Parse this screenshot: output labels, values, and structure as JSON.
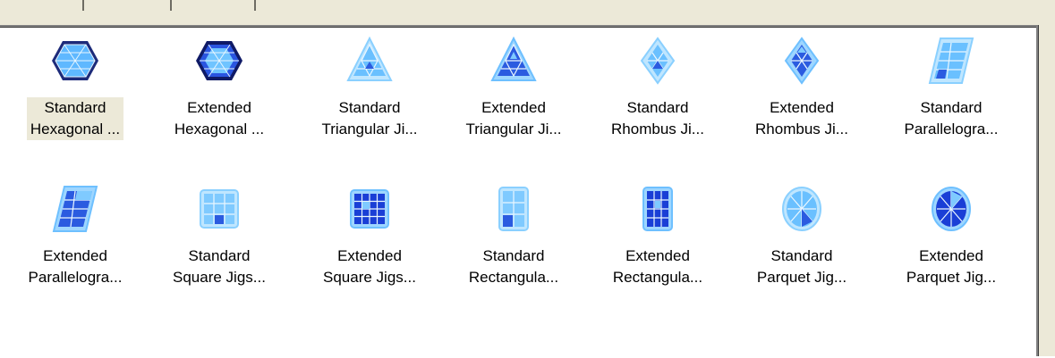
{
  "items": [
    {
      "line1": "Standard",
      "line2": "Hexagonal ...",
      "icon": "hexagon-jigsaw-icon",
      "selected": true
    },
    {
      "line1": "Extended",
      "line2": "Hexagonal ...",
      "icon": "hexagon-jigsaw-extended-icon"
    },
    {
      "line1": "Standard",
      "line2": "Triangular Ji...",
      "icon": "triangle-jigsaw-icon"
    },
    {
      "line1": "Extended",
      "line2": "Triangular Ji...",
      "icon": "triangle-jigsaw-extended-icon"
    },
    {
      "line1": "Standard",
      "line2": "Rhombus Ji...",
      "icon": "rhombus-jigsaw-icon"
    },
    {
      "line1": "Extended",
      "line2": "Rhombus Ji...",
      "icon": "rhombus-jigsaw-extended-icon"
    },
    {
      "line1": "Standard",
      "line2": "Parallelogra...",
      "icon": "parallelogram-jigsaw-icon"
    },
    {
      "line1": "Extended",
      "line2": "Parallelogra...",
      "icon": "parallelogram-jigsaw-extended-icon"
    },
    {
      "line1": "Standard",
      "line2": "Square Jigs...",
      "icon": "square-jigsaw-icon"
    },
    {
      "line1": "Extended",
      "line2": "Square Jigs...",
      "icon": "square-jigsaw-extended-icon"
    },
    {
      "line1": "Standard",
      "line2": "Rectangula...",
      "icon": "rectangle-jigsaw-icon"
    },
    {
      "line1": "Extended",
      "line2": "Rectangula...",
      "icon": "rectangle-jigsaw-extended-icon"
    },
    {
      "line1": "Standard",
      "line2": "Parquet Jig...",
      "icon": "parquet-jigsaw-icon"
    },
    {
      "line1": "Extended",
      "line2": "Parquet Jig...",
      "icon": "parquet-jigsaw-extended-icon"
    }
  ],
  "colors": {
    "light": "#8fd0ff",
    "dark": "#1a3fd6",
    "outline": "#0a2a9a",
    "selected_bg": "#ece9d8"
  }
}
